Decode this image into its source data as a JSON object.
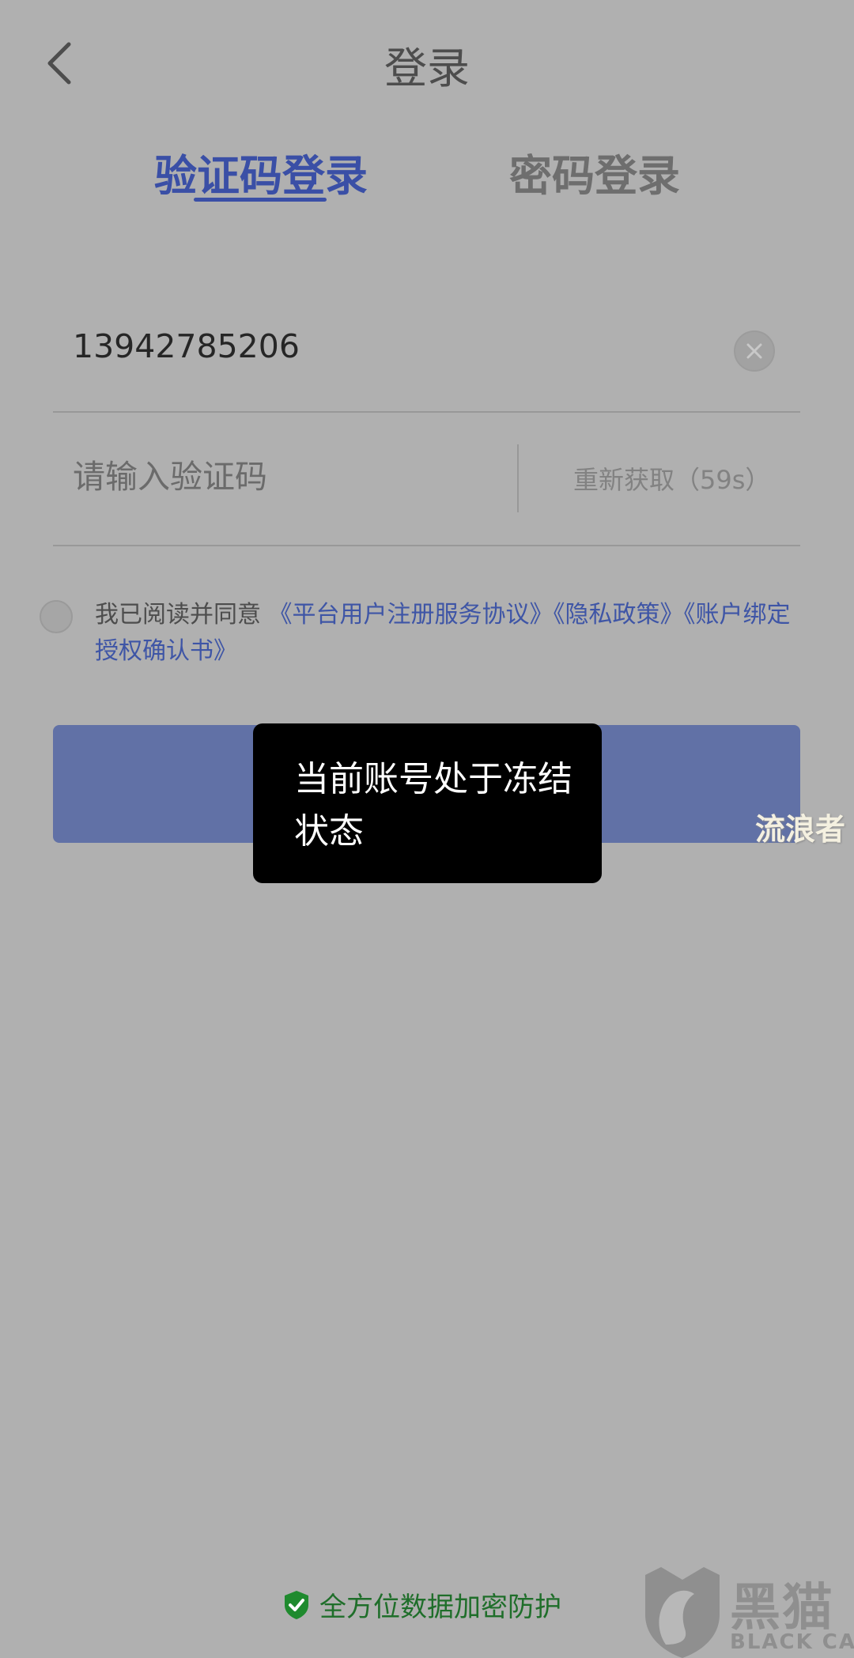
{
  "header": {
    "title": "登录",
    "back_icon": "chevron-left-icon"
  },
  "tabs": [
    {
      "label": "验证码登录",
      "active": true
    },
    {
      "label": "密码登录",
      "active": false
    }
  ],
  "form": {
    "phone_value": "13942785206",
    "clear_icon": "clear-circle-icon",
    "code_placeholder": "请输入验证码",
    "resend_label": "重新获取（59s）"
  },
  "agreement": {
    "prefix": "我已阅读并同意 ",
    "link1": "《平台用户注册服务协议》",
    "link2": "《隐私政策》",
    "link3": "《账户绑定授权确认书》",
    "checked": false
  },
  "toast": {
    "message": "当前账号处于冻结状态"
  },
  "footer": {
    "security_text": "全方位数据加密防护",
    "icon": "shield-check-icon"
  },
  "watermarks": {
    "overlay_text": "流浪者",
    "brand_cn": "黑猫",
    "brand_en": "BLACK CAT"
  },
  "colors": {
    "accent": "#3a4fa6",
    "login_button": "#6171a6",
    "overlay_bg": "#b0b0b0",
    "toast_bg": "#000000",
    "footer_text": "#1f6e2a"
  }
}
